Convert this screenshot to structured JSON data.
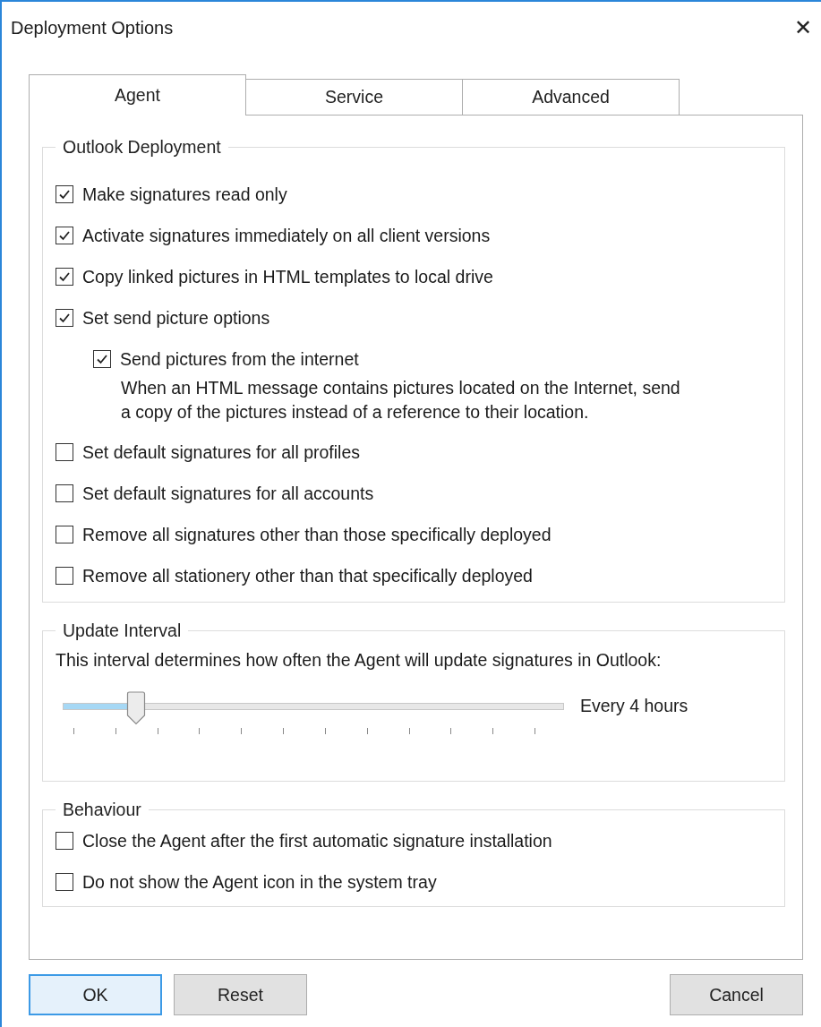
{
  "window": {
    "title": "Deployment Options",
    "close": "✕"
  },
  "tabs": [
    {
      "label": "Agent",
      "selected": true
    },
    {
      "label": "Service",
      "selected": false
    },
    {
      "label": "Advanced",
      "selected": false
    }
  ],
  "outlook_deployment": {
    "title": "Outlook Deployment",
    "options": [
      {
        "label": "Make signatures read only",
        "checked": true
      },
      {
        "label": "Activate signatures immediately on all client versions",
        "checked": true
      },
      {
        "label": "Copy linked pictures in HTML templates to local drive",
        "checked": true
      },
      {
        "label": "Set send picture options",
        "checked": true,
        "children": [
          {
            "label": "Send pictures from the internet",
            "checked": true,
            "description": "When an HTML message contains pictures located on the Internet, send a copy of the pictures instead of a reference to their location."
          }
        ]
      },
      {
        "label": "Set default signatures for all profiles",
        "checked": false
      },
      {
        "label": "Set default signatures for all accounts",
        "checked": false
      },
      {
        "label": "Remove all signatures other than those specifically deployed",
        "checked": false
      },
      {
        "label": "Remove all stationery other than that specifically deployed",
        "checked": false
      }
    ]
  },
  "update_interval": {
    "title": "Update Interval",
    "description": "This interval determines how often the Agent will update signatures in Outlook:",
    "slider": {
      "level": 0.145
    },
    "reading": "Every 4 hours"
  },
  "behaviour": {
    "title": "Behaviour",
    "options": [
      {
        "label": "Close the Agent after the first automatic signature installation",
        "checked": false
      },
      {
        "label": "Do not show the Agent icon in the system tray",
        "checked": false
      }
    ]
  },
  "buttons": [
    {
      "label": "OK",
      "kind": "default"
    },
    {
      "label": "Reset",
      "kind": "normal"
    },
    {
      "label": "Cancel",
      "kind": "normal"
    }
  ]
}
